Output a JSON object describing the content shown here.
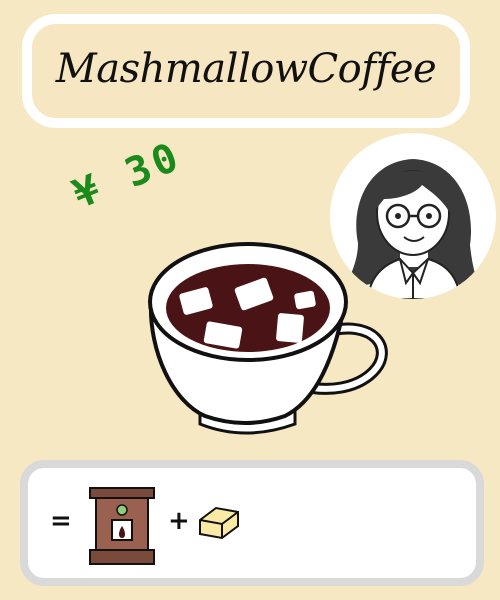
{
  "title": "MashmallowCoffee",
  "price": "¥ 30",
  "recipe": {
    "equals": "=",
    "plus": "+",
    "ingredients": [
      "coffee-machine-icon",
      "marshmallow-icon"
    ]
  },
  "colors": {
    "background": "#f7e8c4",
    "price": "#1a8a1a",
    "coffee": "#4a1316"
  }
}
